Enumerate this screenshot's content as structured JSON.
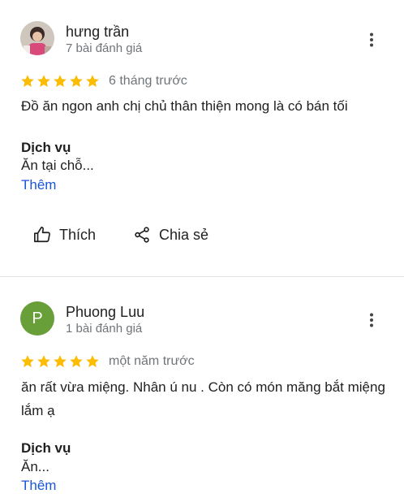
{
  "reviews": [
    {
      "author": "hưng trần",
      "review_count": "7 bài đánh giá",
      "rating": 5,
      "time": "6 tháng trước",
      "text": "Đồ ăn ngon anh chị chủ thân thiện mong là có bán tối",
      "service_label": "Dịch vụ",
      "service_value": "Ăn tại chỗ...",
      "more_label": "Thêm",
      "avatar": "photo"
    },
    {
      "author": "Phuong Luu",
      "avatar_letter": "P",
      "review_count": "1 bài đánh giá",
      "rating": 5,
      "time": "một năm trước",
      "text": "ăn rất vừa miệng. Nhân ú nu . Còn có món măng bắt miệng lắm ạ",
      "service_label": "Dịch vụ",
      "service_value": "Ăn...",
      "more_label": "Thêm"
    }
  ],
  "actions": {
    "like_label": "Thích",
    "share_label": "Chia sẻ"
  },
  "colors": {
    "star": "#fbbc04",
    "link": "#1a56db",
    "avatar_p": "#689f38"
  },
  "icons": [
    "more-vert-icon",
    "star-icon",
    "thumb-up-icon",
    "share-icon"
  ]
}
